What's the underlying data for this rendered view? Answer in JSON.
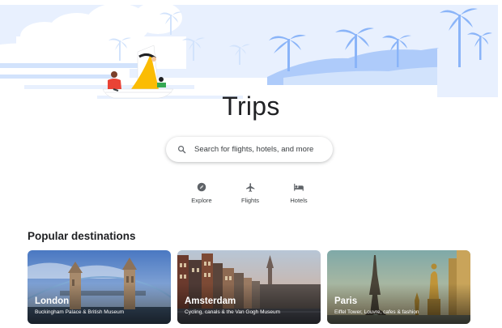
{
  "page": {
    "title": "Trips"
  },
  "search": {
    "placeholder": "Search for flights, hotels, and more"
  },
  "categories": [
    {
      "label": "Explore",
      "icon": "compass-icon"
    },
    {
      "label": "Flights",
      "icon": "airplane-icon"
    },
    {
      "label": "Hotels",
      "icon": "bed-icon"
    }
  ],
  "popular": {
    "heading": "Popular destinations",
    "destinations": [
      {
        "name": "London",
        "description": "Buckingham Palace & British Museum"
      },
      {
        "name": "Amsterdam",
        "description": "Cycling, canals & the Van Gogh Museum"
      },
      {
        "name": "Paris",
        "description": "Eiffel Tower, Louvre, cafes & fashion"
      }
    ]
  },
  "colors": {
    "accent": "#4285f4",
    "hero_blue": "#aecbfa",
    "hero_pale": "#e8f0fe",
    "icon_gray": "#5f6368",
    "sail_yellow": "#fbbc04"
  }
}
